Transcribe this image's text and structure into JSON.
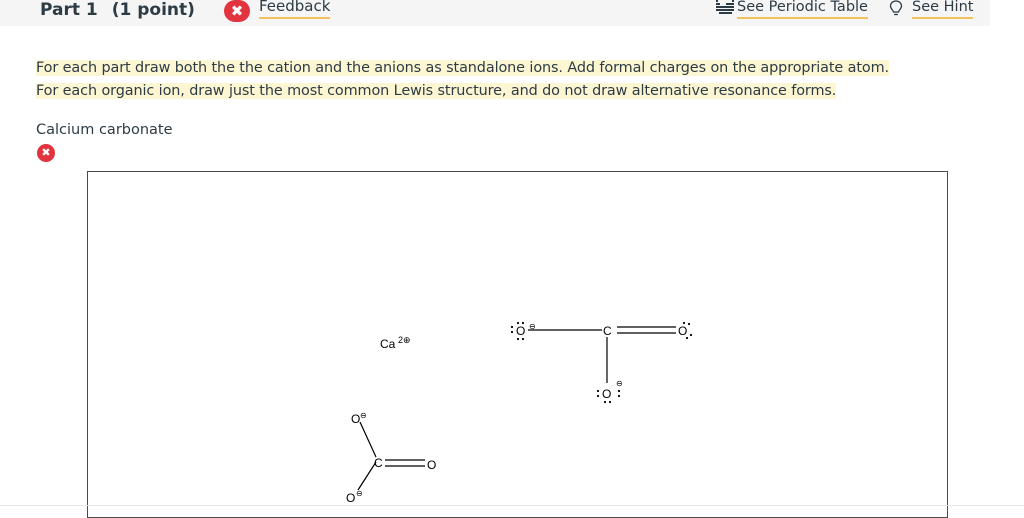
{
  "header": {
    "part_label": "Part 1",
    "points_label": "(1 point)",
    "feedback_status_icon": "x-circle-icon",
    "feedback_label": "Feedback",
    "periodic_table_label": "See Periodic Table",
    "hint_label": "See Hint"
  },
  "instructions": {
    "line1": "For each part draw both the the cation and the anions as standalone ions. Add formal charges on the appropriate atom.",
    "line2": "For each organic ion, draw just the most common Lewis structure, and do not draw alternative resonance forms."
  },
  "question": {
    "label": "Calcium carbonate",
    "status_icon": "x-circle-icon"
  },
  "canvas": {
    "cation": {
      "symbol": "Ca",
      "charge": "2⊕"
    },
    "carbonate_1": {
      "c": "C",
      "o_top": "O",
      "o_right": "O",
      "o_bottom": "O",
      "charge": "⊖"
    },
    "carbonate_2": {
      "c": "C",
      "o_top": "O",
      "o_bottom": "O",
      "o_right": "O",
      "charge": "⊖"
    }
  },
  "colors": {
    "error_red": "#e1343f",
    "link_underline": "#f3c25f",
    "highlight": "#fdf6d3",
    "header_bg": "#f5f5f5"
  }
}
